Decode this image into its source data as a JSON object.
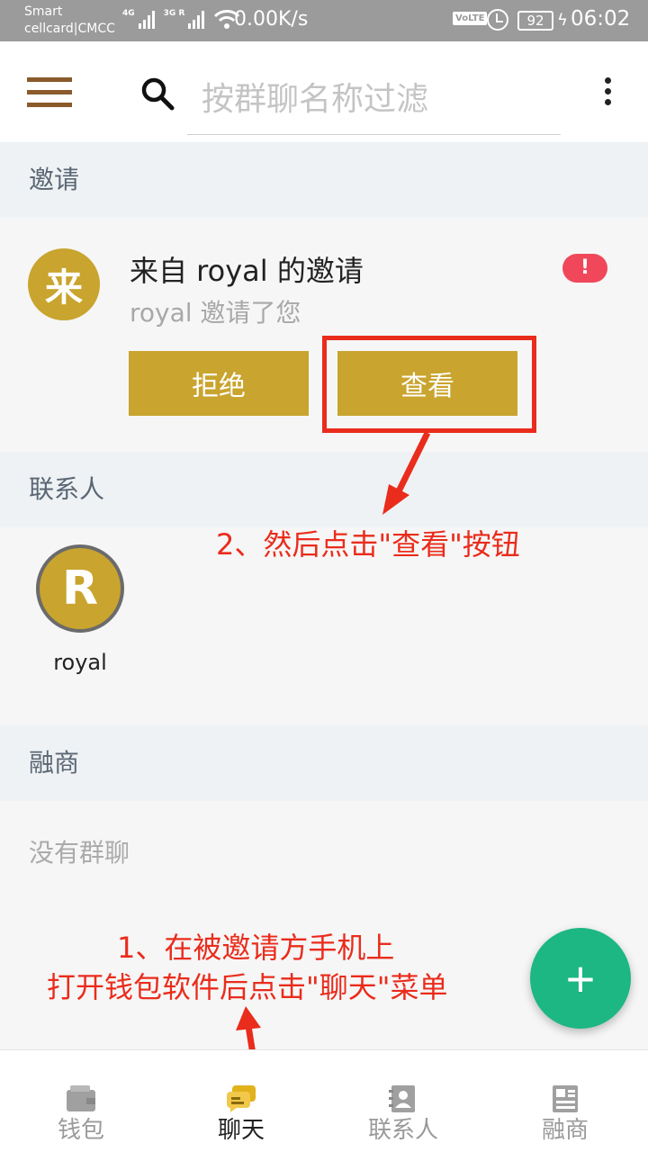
{
  "status_bar": {
    "carrier_line1": "Smart",
    "carrier_line2": "cellcard|CMCC",
    "net1": "4G",
    "net2": "3G R",
    "speed": "0.00K/s",
    "volte": "VoLTE",
    "battery": "92",
    "time": "06:02"
  },
  "app_bar": {
    "search_placeholder": "按群聊名称过滤"
  },
  "sections": {
    "invites": "邀请",
    "contacts": "联系人",
    "groups": "融商"
  },
  "invite": {
    "avatar_char": "来",
    "title": "来自 royal 的邀请",
    "subtitle": "royal 邀请了您",
    "badge": "!",
    "reject_label": "拒绝",
    "view_label": "查看"
  },
  "contacts": [
    {
      "avatar_char": "R",
      "name": "royal"
    }
  ],
  "groups": {
    "empty_text": "没有群聊"
  },
  "fab": {
    "label": "+"
  },
  "annotations": {
    "step2": "2、然后点击\"查看\"按钮",
    "step1_line1": "1、在被邀请方手机上",
    "step1_line2": "打开钱包软件后点击\"聊天\"菜单",
    "color": "#ea2c1c"
  },
  "bottom_nav": {
    "active": "聊天",
    "items": [
      {
        "label": "钱包",
        "icon": "wallet-icon"
      },
      {
        "label": "聊天",
        "icon": "chat-icon"
      },
      {
        "label": "联系人",
        "icon": "contacts-book-icon"
      },
      {
        "label": "融商",
        "icon": "news-icon"
      }
    ]
  },
  "colors": {
    "accent": "#c9a42e",
    "fab": "#1cb783",
    "badge": "#f0485a",
    "menu": "#8a5a2b"
  }
}
